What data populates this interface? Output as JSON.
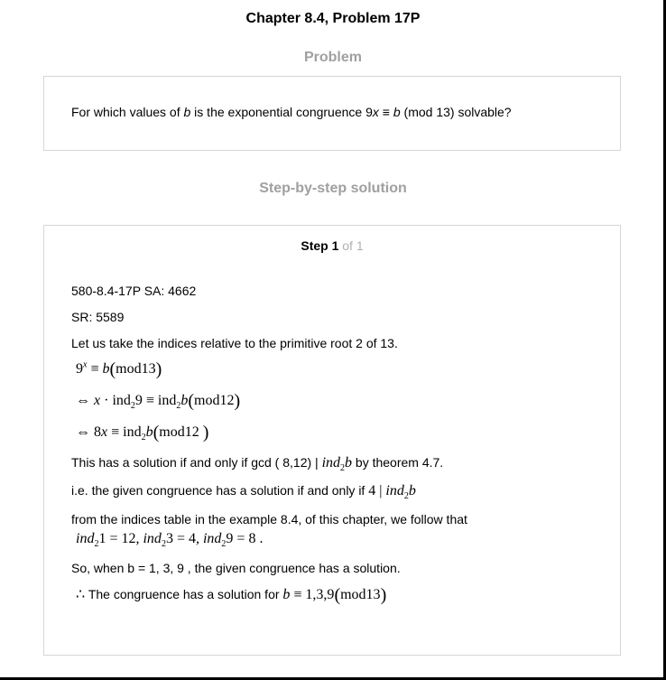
{
  "header": {
    "title": "Chapter 8.4, Problem 17P",
    "problem_heading": "Problem",
    "solution_heading": "Step-by-step solution"
  },
  "problem": {
    "pre": "For which values of ",
    "var_b": "b",
    "mid": " is the exponential congruence 9",
    "var_x": "x",
    "eq": " ≡ ",
    "var_b2": "b",
    "post": " (mod 13) solvable?"
  },
  "step": {
    "label": "Step 1",
    "of": " of 1",
    "line1": "580-8.4-17P SA: 4662",
    "line2": "SR: 5589",
    "line3": "Let us take the indices relative to the primitive root 2 of 13.",
    "eq1": {
      "base": "9",
      "sup": "x",
      "rel": " ≡ ",
      "b": "b",
      "mod": "mod13"
    },
    "eq2": {
      "iff": "⇔ ",
      "x": "x",
      "dot": " · ind",
      "sub": "2",
      "nine": "9 ≡ ind",
      "sub2": "2",
      "b": "b",
      "mod": "mod12"
    },
    "eq3": {
      "iff": "⇔ ",
      "lhs": "8",
      "x": "x",
      "rel": " ≡ ind",
      "sub": "2",
      "b": "b",
      "mod": "mod12 "
    },
    "line4": {
      "pre": "This has a solution if and only if gcd ( 8,12) |  ",
      "ind": "ind",
      "sub": "2",
      "b": "b",
      "post": " by theorem 4.7."
    },
    "line5": {
      "pre": "i.e. the given congruence has a solution if and only if  ",
      "four": "4 | ",
      "ind": "ind",
      "sub": "2",
      "b": "b"
    },
    "line6": "from the indices table in the example 8.4, of this chapter, we follow that",
    "line7": {
      "ind1": "ind",
      "sub1": "2",
      "v1": "1 = 12, ",
      "ind2": "ind",
      "sub2": "2",
      "v2": "3 = 4, ",
      "ind3": "ind",
      "sub3": "2",
      "v3": "9 = 8 ."
    },
    "line8": "So, when b = 1, 3, 9 , the given congruence has a solution.",
    "line9": {
      "therefore": "∴",
      "text": " The congruence has a solution for  ",
      "b": "b",
      "rel": " ≡ 1,3,9",
      "mod": "mod13"
    }
  }
}
